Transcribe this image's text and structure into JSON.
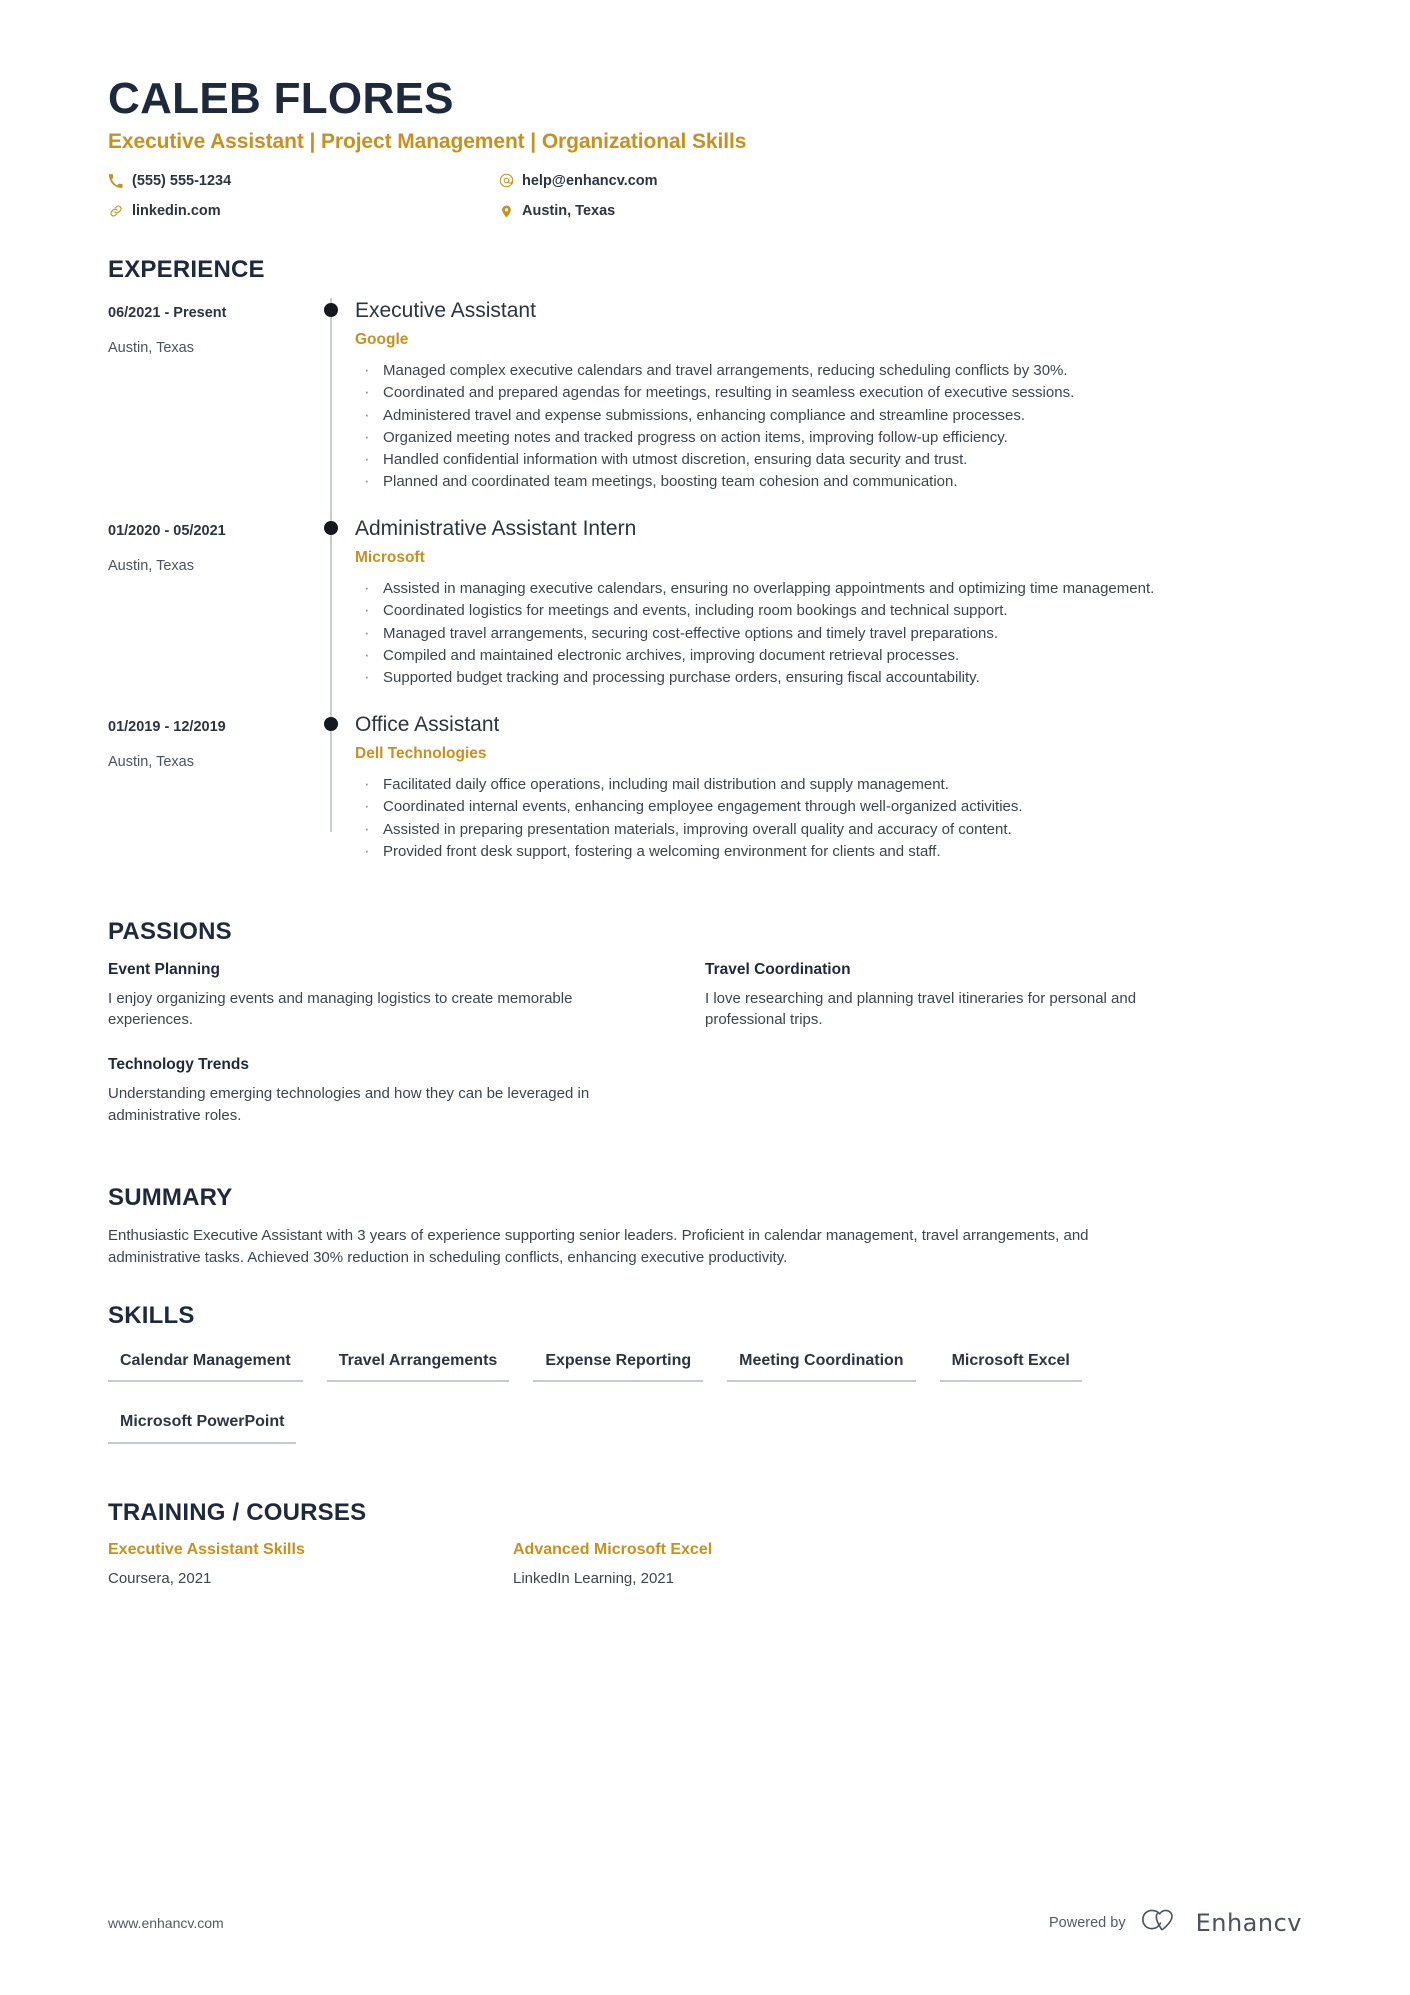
{
  "header": {
    "name": "CALEB FLORES",
    "headline": "Executive Assistant | Project Management | Organizational Skills",
    "contacts": [
      {
        "icon": "phone-icon",
        "text": "(555) 555-1234"
      },
      {
        "icon": "email-icon",
        "text": "help@enhancv.com"
      },
      {
        "icon": "link-icon",
        "text": "linkedin.com"
      },
      {
        "icon": "location-pin-icon",
        "text": "Austin, Texas"
      }
    ]
  },
  "experience": {
    "title": "EXPERIENCE",
    "entries": [
      {
        "date": "06/2021 - Present",
        "location": "Austin, Texas",
        "role": "Executive Assistant",
        "company": "Google",
        "bullets": [
          "Managed complex executive calendars and travel arrangements, reducing scheduling conflicts by 30%.",
          "Coordinated and prepared agendas for meetings, resulting in seamless execution of executive sessions.",
          "Administered travel and expense submissions, enhancing compliance and streamline processes.",
          "Organized meeting notes and tracked progress on action items, improving follow-up efficiency.",
          "Handled confidential information with utmost discretion, ensuring data security and trust.",
          "Planned and coordinated team meetings, boosting team cohesion and communication."
        ]
      },
      {
        "date": "01/2020 - 05/2021",
        "location": "Austin, Texas",
        "role": "Administrative Assistant Intern",
        "company": "Microsoft",
        "bullets": [
          "Assisted in managing executive calendars, ensuring no overlapping appointments and optimizing time management.",
          "Coordinated logistics for meetings and events, including room bookings and technical support.",
          "Managed travel arrangements, securing cost-effective options and timely travel preparations.",
          "Compiled and maintained electronic archives, improving document retrieval processes.",
          "Supported budget tracking and processing purchase orders, ensuring fiscal accountability."
        ]
      },
      {
        "date": "01/2019 - 12/2019",
        "location": "Austin, Texas",
        "role": "Office Assistant",
        "company": "Dell Technologies",
        "bullets": [
          "Facilitated daily office operations, including mail distribution and supply management.",
          "Coordinated internal events, enhancing employee engagement through well-organized activities.",
          "Assisted in preparing presentation materials, improving overall quality and accuracy of content.",
          "Provided front desk support, fostering a welcoming environment for clients and staff."
        ]
      }
    ]
  },
  "passions": {
    "title": "PASSIONS",
    "items": [
      {
        "title": "Event Planning",
        "description": "I enjoy organizing events and managing logistics to create memorable experiences."
      },
      {
        "title": "Travel Coordination",
        "description": "I love researching and planning travel itineraries for personal and professional trips."
      },
      {
        "title": "Technology Trends",
        "description": "Understanding emerging technologies and how they can be leveraged in administrative roles."
      }
    ]
  },
  "summary": {
    "title": "SUMMARY",
    "text": "Enthusiastic Executive Assistant with 3 years of experience supporting senior leaders. Proficient in calendar management, travel arrangements, and administrative tasks. Achieved 30% reduction in scheduling conflicts, enhancing executive productivity."
  },
  "skills": {
    "title": "SKILLS",
    "items": [
      "Calendar Management",
      "Travel Arrangements",
      "Expense Reporting",
      "Meeting Coordination",
      "Microsoft Excel",
      "Microsoft PowerPoint"
    ]
  },
  "training": {
    "title": "TRAINING / COURSES",
    "items": [
      {
        "title": "Executive Assistant Skills",
        "subtitle": "Coursera, 2021"
      },
      {
        "title": "Advanced Microsoft Excel",
        "subtitle": "LinkedIn Learning, 2021"
      }
    ]
  },
  "footer": {
    "url": "www.enhancv.com",
    "powered_by": "Powered by",
    "brand": "Enhancv"
  },
  "colors": {
    "accent": "#c8901e",
    "navy": "#1e2a3c",
    "body": "#3c444f",
    "rule": "#c5cad0"
  }
}
